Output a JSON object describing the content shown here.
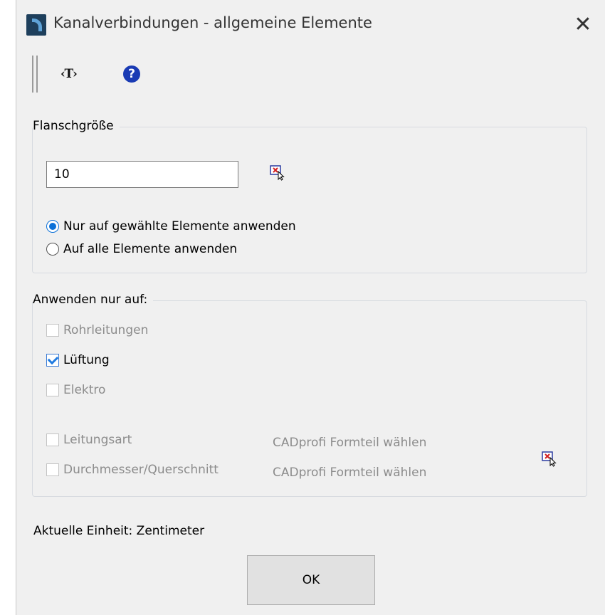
{
  "window": {
    "title": "Kanalverbindungen - allgemeine Elemente",
    "close_glyph": "✕",
    "app_icon": "cadprofi-logo-icon"
  },
  "toolbar": {
    "text_tool_label": "‹T›",
    "help_glyph": "?",
    "help_icon": "help-icon"
  },
  "flange": {
    "legend": "Flanschgröße",
    "value": "10",
    "pick_icon": "pick-element-icon",
    "options": [
      {
        "label": "Nur auf gewählte Elemente anwenden",
        "checked": true
      },
      {
        "label": "Auf alle Elemente anwenden",
        "checked": false
      }
    ]
  },
  "apply": {
    "legend": "Anwenden nur auf:",
    "items": [
      {
        "label": "Rohrleitungen",
        "checked": false,
        "enabled": false
      },
      {
        "label": "Lüftung",
        "checked": true,
        "enabled": true
      },
      {
        "label": "Elektro",
        "checked": false,
        "enabled": false
      }
    ],
    "filters": [
      {
        "label": "Leitungsart",
        "checked": false,
        "enabled": false,
        "value": "CADprofi Formteil wählen"
      },
      {
        "label": "Durchmesser/Querschnitt",
        "checked": false,
        "enabled": false,
        "value": "CADprofi Formteil wählen"
      }
    ],
    "pick_icon": "pick-element-icon"
  },
  "status": {
    "unit_text": "Aktuelle Einheit: Zentimeter"
  },
  "buttons": {
    "ok_label": "OK"
  },
  "colors": {
    "accent": "#0a70d8",
    "help": "#1a3bb4",
    "pick_red": "#d42020"
  }
}
